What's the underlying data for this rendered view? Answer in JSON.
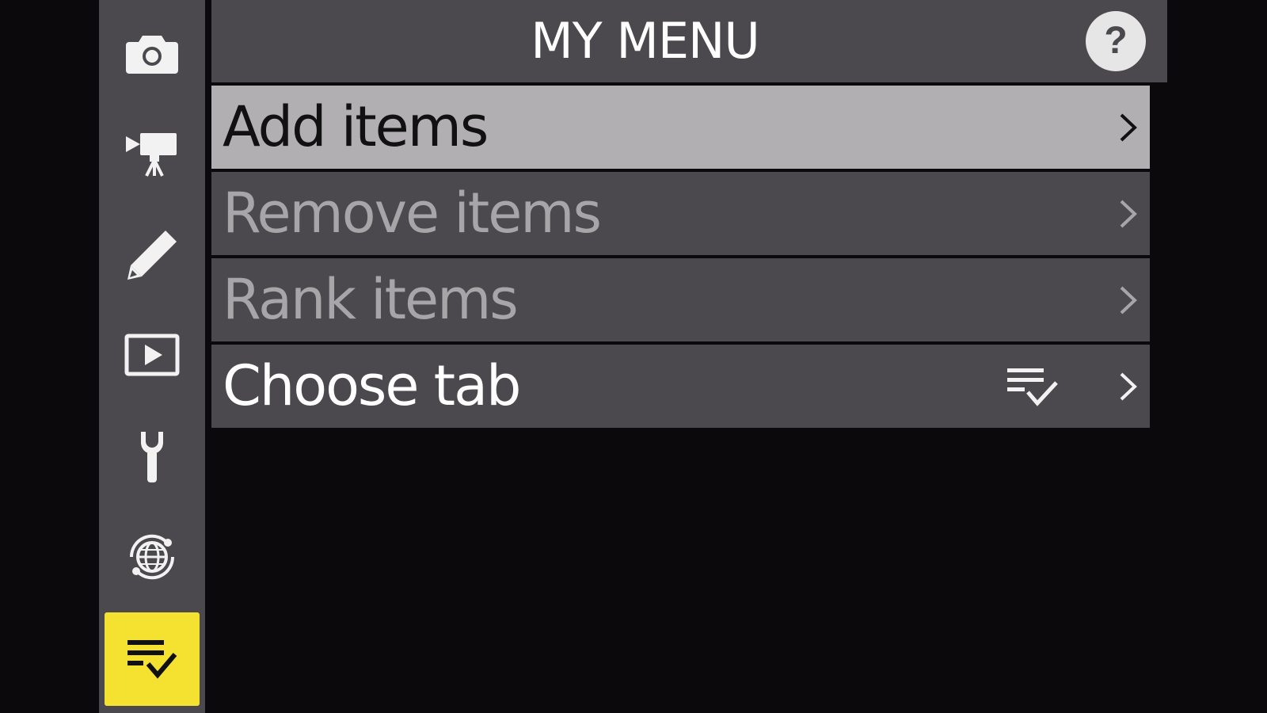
{
  "header": {
    "title": "MY MENU",
    "help_label": "?"
  },
  "sidebar": {
    "tabs": [
      {
        "name": "photo-shooting-menu",
        "icon": "camera-icon",
        "active": false
      },
      {
        "name": "video-recording-menu",
        "icon": "movie-camera-icon",
        "active": false
      },
      {
        "name": "custom-settings-menu",
        "icon": "pencil-icon",
        "active": false
      },
      {
        "name": "playback-menu",
        "icon": "playback-icon",
        "active": false
      },
      {
        "name": "setup-menu",
        "icon": "wrench-icon",
        "active": false
      },
      {
        "name": "network-menu",
        "icon": "network-globe-icon",
        "active": false
      },
      {
        "name": "my-menu",
        "icon": "my-menu-icon",
        "active": true
      }
    ]
  },
  "menu": {
    "items": [
      {
        "label": "Add items",
        "state": "selected"
      },
      {
        "label": "Remove items",
        "state": "disabled"
      },
      {
        "label": "Rank items",
        "state": "disabled"
      },
      {
        "label": "Choose tab",
        "state": "normal",
        "value_icon": "my-menu-icon"
      }
    ]
  },
  "colors": {
    "background": "#0b090c",
    "panel": "#4b494d",
    "selected_row": "#b1afb1",
    "active_tab": "#f5e12f",
    "disabled_text": "#a7a5a7"
  }
}
